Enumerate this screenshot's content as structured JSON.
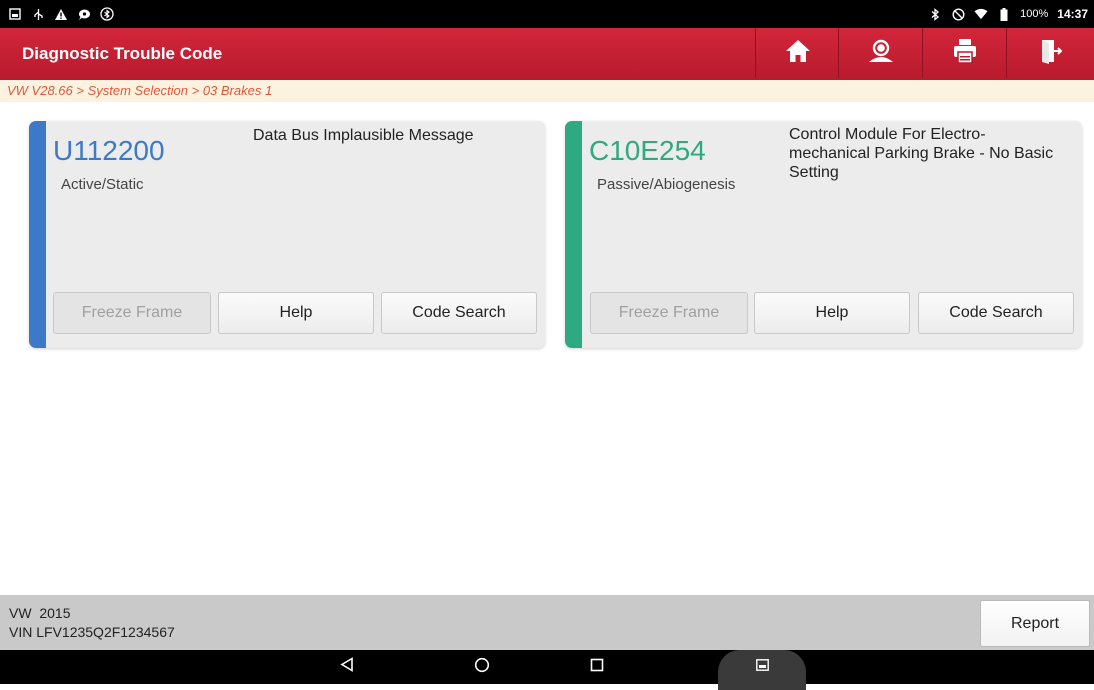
{
  "status_bar": {
    "left_icons": [
      "notification-icon",
      "usb-icon",
      "warning-icon",
      "chat-icon",
      "bluetooth-circle-icon"
    ],
    "right_icons": [
      "bluetooth-icon",
      "do-not-disturb-icon",
      "wifi-icon",
      "battery-icon"
    ],
    "battery": "100%",
    "time": "14:37"
  },
  "header": {
    "title": "Diagnostic Trouble Code",
    "buttons": [
      "home-icon",
      "support-icon",
      "print-icon",
      "exit-icon"
    ],
    "accent_color": "#c8223a"
  },
  "breadcrumb": "VW V28.66 > System Selection > 03 Brakes 1",
  "dtcs": [
    {
      "code": "U112200",
      "status": "Active/Static",
      "description": "Data Bus Implausible Message",
      "color": "#3c7ac9",
      "buttons": {
        "freeze_frame": "Freeze Frame",
        "help": "Help",
        "code_search": "Code Search"
      }
    },
    {
      "code": "C10E254",
      "status": "Passive/Abiogenesis",
      "description": "Control Module For Electro-mechanical Parking Brake - No Basic Setting",
      "color": "#2fa981",
      "buttons": {
        "freeze_frame": "Freeze Frame",
        "help": "Help",
        "code_search": "Code Search"
      }
    }
  ],
  "footer": {
    "vehicle_line1": "VW  2015",
    "vehicle_line2": "VIN LFV1235Q2F1234567",
    "report_label": "Report"
  },
  "nav_bar": [
    "back-icon",
    "home-circle-icon",
    "recents-icon",
    "screenshot-icon"
  ]
}
